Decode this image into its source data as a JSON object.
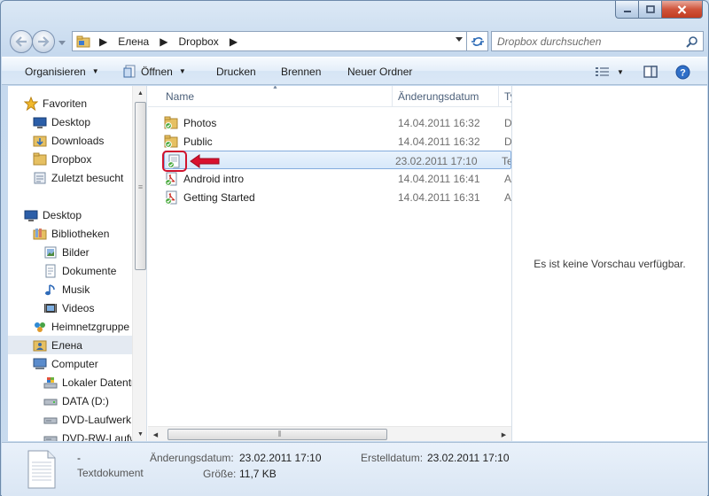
{
  "window": {
    "caption_buttons": [
      "minimize-icon",
      "maximize-icon",
      "close-icon"
    ]
  },
  "address": {
    "crumbs": [
      "Елена",
      "Dropbox"
    ],
    "search_placeholder": "Dropbox durchsuchen"
  },
  "toolbar": {
    "organize": "Organisieren",
    "open": "Öffnen",
    "print": "Drucken",
    "burn": "Brennen",
    "new_folder": "Neuer Ordner"
  },
  "nav": {
    "favorites": "Favoriten",
    "desktop_fav": "Desktop",
    "downloads": "Downloads",
    "dropbox": "Dropbox",
    "recent": "Zuletzt besucht",
    "desktop": "Desktop",
    "libraries": "Bibliotheken",
    "pictures": "Bilder",
    "documents": "Dokumente",
    "music": "Musik",
    "videos": "Videos",
    "homegroup": "Heimnetzgruppe",
    "user": "Елена",
    "computer": "Computer",
    "local_disk": "Lokaler Datenträ",
    "data_d": "DATA (D:)",
    "dvd": "DVD-Laufwerk",
    "dvdrw": "DVD-RW-Laufw"
  },
  "columns": {
    "name": "Name",
    "modified": "Änderungsdatum",
    "type": "Typ"
  },
  "files": [
    {
      "name": "Photos",
      "date": "14.04.2011 16:32",
      "type": "Dateiordner",
      "icon": "dropbox-folder-icon"
    },
    {
      "name": "Public",
      "date": "14.04.2011 16:32",
      "type": "Dateiordner",
      "icon": "dropbox-folder-icon"
    },
    {
      "name": "",
      "date": "23.02.2011 17:10",
      "type": "Textdokument",
      "icon": "text-document-icon"
    },
    {
      "name": "Android intro",
      "date": "14.04.2011 16:41",
      "type": "Adobe Acrobat",
      "icon": "pdf-icon"
    },
    {
      "name": "Getting Started",
      "date": "14.04.2011 16:31",
      "type": "Adobe Acrobat",
      "icon": "pdf-icon"
    }
  ],
  "preview": {
    "message": "Es ist keine Vorschau verfügbar."
  },
  "details": {
    "name": "-",
    "type": "Textdokument",
    "modified_label": "Änderungsdatum:",
    "modified_value": "23.02.2011 17:10",
    "created_label": "Erstelldatum:",
    "created_value": "23.02.2011 17:10",
    "size_label": "Größe:",
    "size_value": "11,7 KB"
  }
}
